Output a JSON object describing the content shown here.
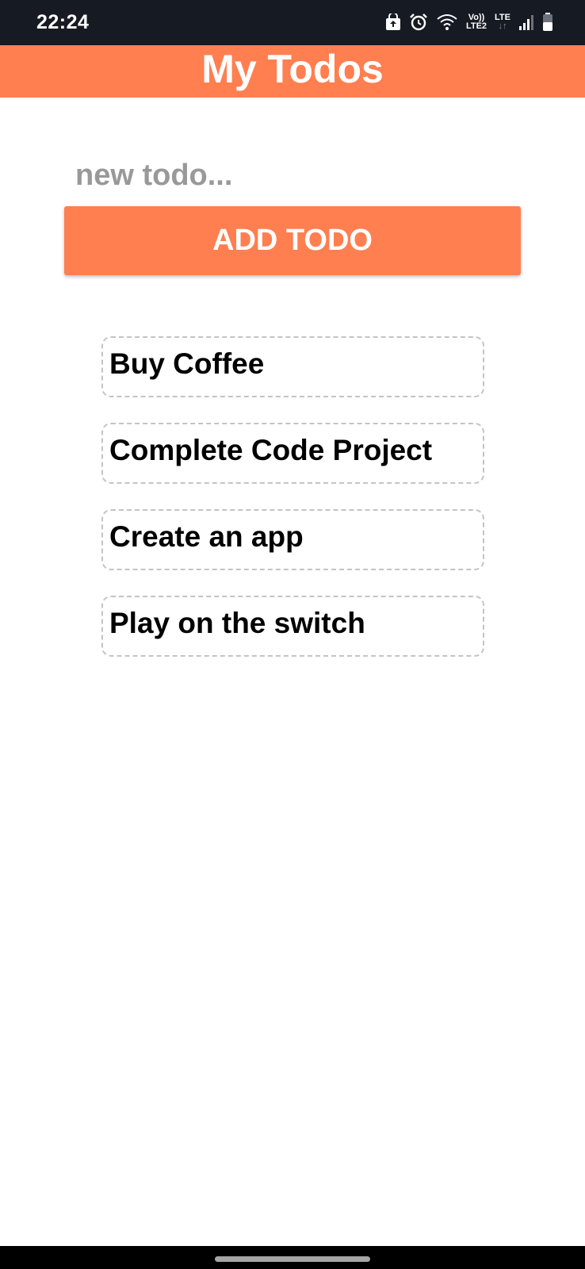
{
  "status_bar": {
    "time": "22:24",
    "volte_label": "Vo))",
    "lte2_label": "LTE2",
    "lte_label": "LTE",
    "icons": [
      "vpn-lock-icon",
      "alarm-icon",
      "wifi-icon",
      "signal-icon",
      "battery-icon"
    ],
    "background": "#161a22"
  },
  "header": {
    "title": "My Todos",
    "color": "#ff7f50"
  },
  "input": {
    "value": "",
    "placeholder": "new todo..."
  },
  "add_button": {
    "label": "ADD TODO",
    "color": "#ff7f50"
  },
  "todos": [
    {
      "text": "Buy Coffee"
    },
    {
      "text": "Complete Code Project"
    },
    {
      "text": "Create an app"
    },
    {
      "text": "Play on the switch"
    }
  ]
}
